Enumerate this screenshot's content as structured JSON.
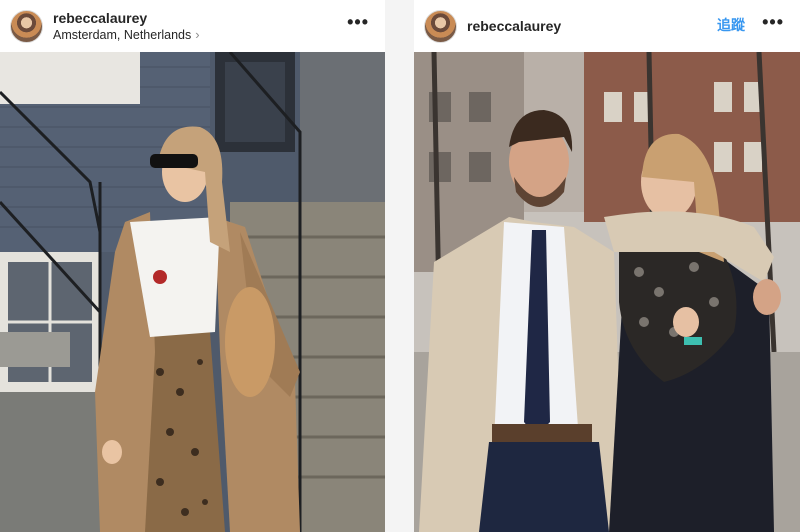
{
  "posts": [
    {
      "username": "rebeccalaurey",
      "location": "Amsterdam, Netherlands",
      "more_icon": "more-horizontal-icon",
      "photo_alt": "woman-street-photo"
    },
    {
      "username": "rebeccalaurey",
      "follow_label": "追蹤",
      "more_icon": "more-horizontal-icon",
      "photo_alt": "couple-photo"
    }
  ],
  "colors": {
    "link_blue": "#3897f0",
    "text": "#262626",
    "muted": "#8e8e8e"
  }
}
